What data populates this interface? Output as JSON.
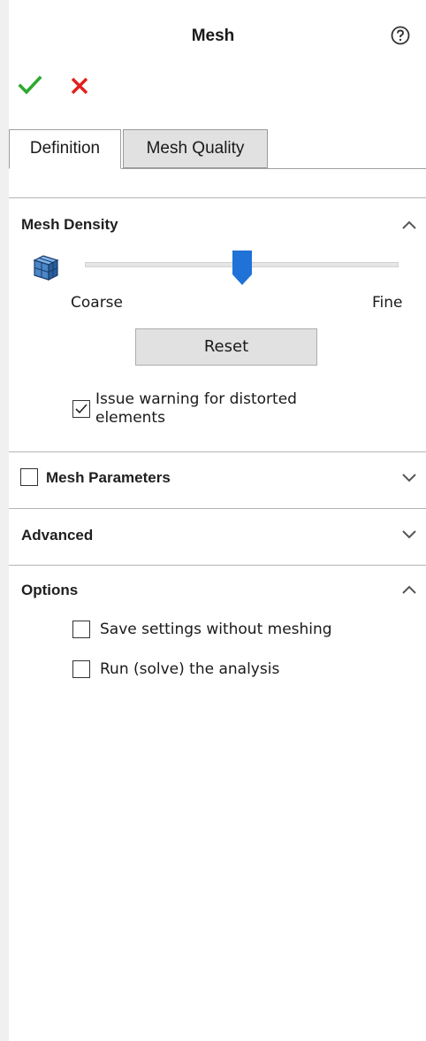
{
  "header": {
    "title": "Mesh",
    "help_icon": "help-circle-icon",
    "ok_icon": "checkmark-icon",
    "cancel_icon": "close-x-icon"
  },
  "tabs": [
    {
      "label": "Definition",
      "active": true
    },
    {
      "label": "Mesh Quality",
      "active": false
    }
  ],
  "mesh_density": {
    "title": "Mesh Density",
    "expanded": true,
    "slider": {
      "min_label": "Coarse",
      "max_label": "Fine",
      "value_fraction": 0.5
    },
    "reset_label": "Reset",
    "distortion_warning": {
      "label_line1": "Issue warning for distorted",
      "label_line2": "elements",
      "checked": true
    }
  },
  "mesh_parameters": {
    "title": "Mesh Parameters",
    "checked": false,
    "expanded": false
  },
  "advanced": {
    "title": "Advanced",
    "expanded": false
  },
  "options": {
    "title": "Options",
    "expanded": true,
    "items": [
      {
        "label": "Save settings without meshing",
        "checked": false
      },
      {
        "label": "Run (solve) the analysis",
        "checked": false
      }
    ]
  },
  "colors": {
    "ok_green": "#2ea82e",
    "cancel_red": "#e0201b",
    "slider_thumb": "#1f72d6"
  }
}
